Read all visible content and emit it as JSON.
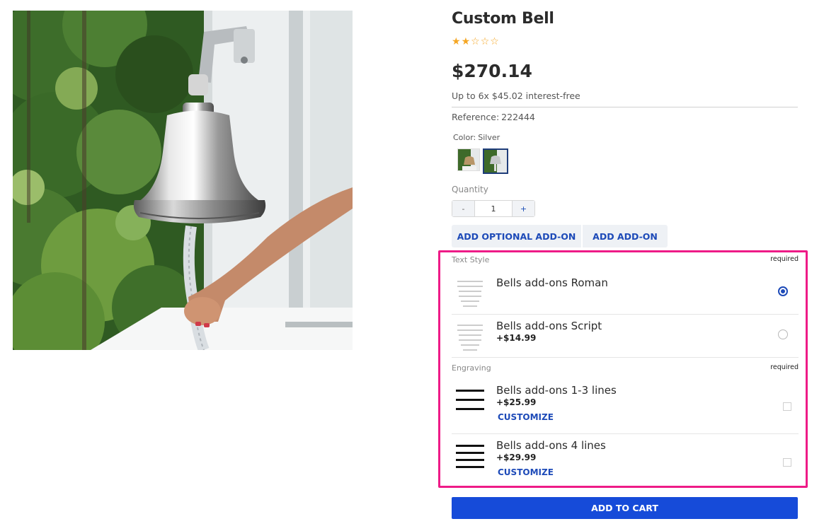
{
  "product": {
    "title": "Custom Bell",
    "rating": 2,
    "rating_max": 5,
    "price": "$270.14",
    "installments": "Up to 6x $45.02 interest-free",
    "reference_label": "Reference:",
    "reference_value": "222444",
    "color_label": "Color:",
    "color_value": "Silver",
    "swatches": [
      {
        "name": "bell-variant-1",
        "selected": false
      },
      {
        "name": "bell-variant-silver",
        "selected": true
      }
    ],
    "quantity_label": "Quantity",
    "quantity_value": "1",
    "quantity_minus": "-",
    "quantity_plus": "+"
  },
  "tabs": {
    "optional": "ADD OPTIONAL ADD-ON",
    "addon": "ADD ADD-ON"
  },
  "addons": {
    "text_style": {
      "title": "Text Style",
      "required": "required",
      "options": [
        {
          "name": "Bells add-ons Roman",
          "price": "",
          "selected": true
        },
        {
          "name": "Bells add-ons Script",
          "price": "+$14.99",
          "selected": false
        }
      ]
    },
    "engraving": {
      "title": "Engraving",
      "required": "required",
      "options": [
        {
          "name": "Bells add-ons 1-3 lines",
          "price": "+$25.99",
          "action": "CUSTOMIZE",
          "checked": false
        },
        {
          "name": "Bells add-ons 4 lines",
          "price": "+$29.99",
          "action": "CUSTOMIZE",
          "checked": false
        }
      ]
    }
  },
  "cart": {
    "button": "ADD TO CART"
  },
  "colors": {
    "accent_blue": "#164bd9",
    "highlight_pink": "#ee1b87",
    "star": "#f5a623"
  }
}
